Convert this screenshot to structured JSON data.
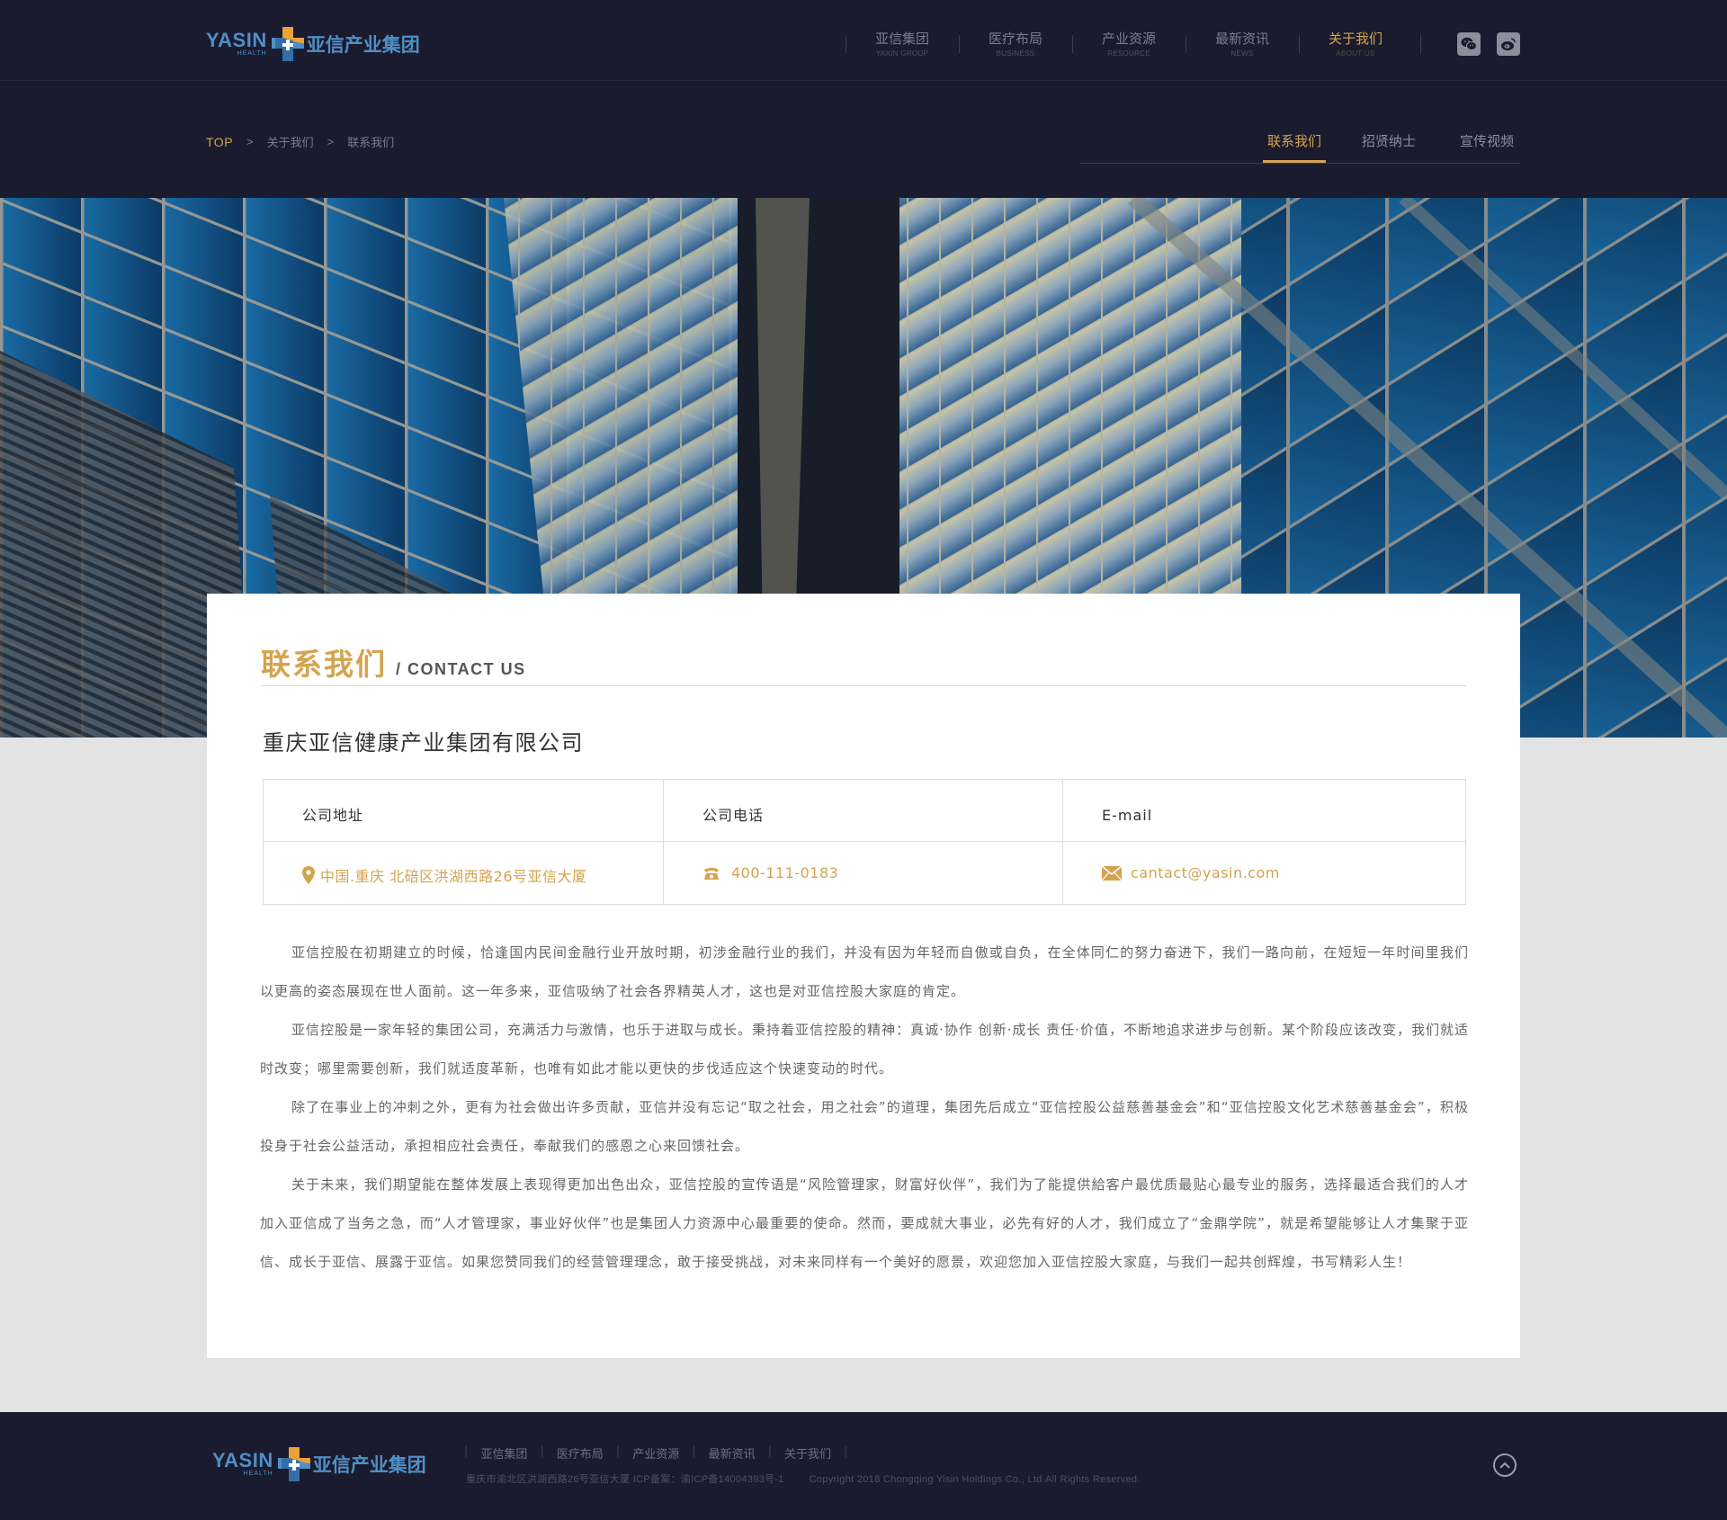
{
  "header": {
    "logo": {
      "en": "YASIN",
      "sub": "HEALTH",
      "cn": "亚信产业集团"
    },
    "nav": [
      {
        "cn": "亚信集团",
        "en": "YAXIN GROUP"
      },
      {
        "cn": "医疗布局",
        "en": "BUSINESS"
      },
      {
        "cn": "产业资源",
        "en": "RESOURCE"
      },
      {
        "cn": "最新资讯",
        "en": "NEWS"
      },
      {
        "cn": "关于我们",
        "en": "ABOUT US",
        "active": true
      }
    ],
    "social": [
      "wechat-icon",
      "weibo-icon"
    ]
  },
  "breadcrumb": {
    "top": "TOP",
    "sep": ">",
    "level1": "关于我们",
    "level2": "联系我们"
  },
  "subtabs": [
    "联系我们",
    "招贤纳士",
    "宣传视频"
  ],
  "content": {
    "title_cn": "联系我们",
    "title_en": "/ CONTACT US",
    "company": "重庆亚信健康产业集团有限公司",
    "contact": {
      "address_label": "公司地址",
      "address": "中国.重庆 北碚区洪湖西路26号亚信大厦",
      "phone_label": "公司电话",
      "phone": "400-111-0183",
      "email_label": "E-mail",
      "email": "cantact@yasin.com"
    },
    "paragraphs": [
      "亚信控股在初期建立的时候，恰逢国内民间金融行业开放时期，初涉金融行业的我们，并没有因为年轻而自傲或自负，在全体同仁的努力奋进下，我们一路向前，在短短一年时间里我们以更高的姿态展现在世人面前。这一年多来，亚信吸纳了社会各界精英人才，这也是对亚信控股大家庭的肯定。",
      "亚信控股是一家年轻的集团公司，充满活力与激情，也乐于进取与成长。秉持着亚信控股的精神：真诚·协作 创新·成长 责任·价值，不断地追求进步与创新。某个阶段应该改变，我们就适时改变；哪里需要创新，我们就适度革新，也唯有如此才能以更快的步伐适应这个快速变动的时代。",
      "除了在事业上的冲刺之外，更有为社会做出许多贡献，亚信并没有忘记“取之社会，用之社会”的道理，集团先后成立“亚信控股公益慈善基金会”和“亚信控股文化艺术慈善基金会”，积极投身于社会公益活动，承担相应社会责任，奉献我们的感恩之心来回馈社会。",
      "关于未来，我们期望能在整体发展上表现得更加出色出众，亚信控股的宣传语是“风险管理家，财富好伙伴”，我们为了能提供給客户最优质最贴心最专业的服务，选择最适合我们的人才加入亚信成了当务之急，而“人才管理家，事业好伙伴”也是集团人力资源中心最重要的使命。然而，要成就大事业，必先有好的人才，我们成立了“金鼎学院”，就是希望能够让人才集聚于亚信、成长于亚信、展露于亚信。如果您赞同我们的经营管理理念，敢于接受挑战，对未来同样有一个美好的愿景，欢迎您加入亚信控股大家庭，与我们一起共创辉煌，书写精彩人生！"
    ]
  },
  "footer": {
    "nav": [
      "亚信集团",
      "医疗布局",
      "产业资源",
      "最新资讯",
      "关于我们"
    ],
    "address_icp": "重庆市渝北区洪湖西路26号亚信大厦 ICP备案：渝ICP备14004393号-1",
    "copyright": "Copyright   2018 Chongqing Yisin Holdings Co., Ltd.All Rights Reserved."
  },
  "colors": {
    "accent": "#d3a450",
    "dark_bg": "#1a1b2e",
    "brand_blue": "#4f8fc6",
    "page_bg": "#e3e3e4"
  }
}
